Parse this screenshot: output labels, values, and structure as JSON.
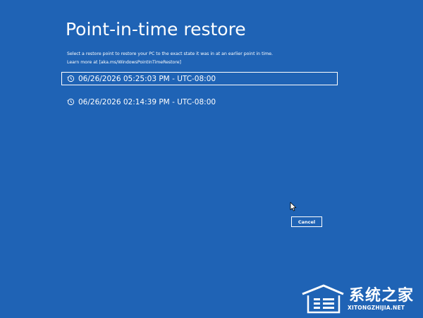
{
  "page": {
    "title": "Point-in-time restore",
    "description_line1": "Select a restore point to restore your PC to the exact state it was in at an earlier point in time.",
    "description_line2": "Learn more at [aka.ms/WindowsPointInTimeRestore]"
  },
  "restore_points": [
    {
      "label": "06/26/2026 05:25:03 PM - UTC-08:00",
      "selected": true,
      "icon": "history-icon"
    },
    {
      "label": "06/26/2026 02:14:39 PM - UTC-08:00",
      "selected": false,
      "icon": "history-icon"
    }
  ],
  "actions": {
    "cancel_label": "Cancel"
  },
  "watermark": {
    "cn_text": "系统之家",
    "en_text": "XITONGZHIJIA.NET"
  },
  "colors": {
    "background": "#1f63b5",
    "foreground": "#ffffff"
  }
}
